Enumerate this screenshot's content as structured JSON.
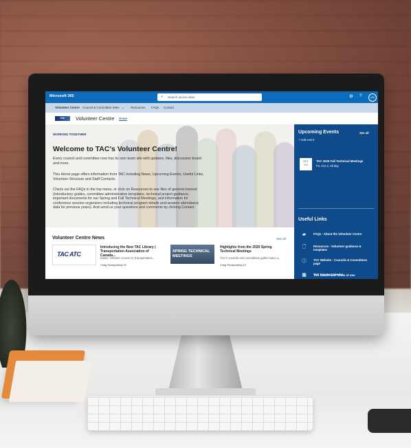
{
  "suite": {
    "brand": "Microsoft 365",
    "search_placeholder": "Search across sites",
    "settings_icon": "gear-icon",
    "help_icon": "help-icon",
    "avatar": "CB"
  },
  "hub_nav": {
    "items": [
      "Volunteer Centre",
      "Council & Committee Sites",
      "Resources",
      "FAQs",
      "Contact"
    ]
  },
  "site": {
    "logo": "TAC",
    "title": "Volunteer Centre",
    "home_link": "Home"
  },
  "hero": {
    "tag": "WORKING TOGETHER",
    "title": "Welcome to TAC's Volunteer Centre!",
    "p1": "Every council and committee now has its own team site with updates, files, discussion board and more.",
    "p2": "This Home page offers information from TAC including News, Upcoming Events, Useful Links, Volunteer Structure and Staff Contacts.",
    "p3": "Check out the FAQs in the top menu, or click on Resources to see files of general interest (introductory guides, committee administration templates, technical project guidance, important documents for our Spring and Fall Technical Meetings, and information for conference session organizers including technical program details and session attendance data for previous years). And send us your questions and comments by clicking Contact."
  },
  "news": {
    "heading": "Volunteer Centre News",
    "see_all": "See all",
    "items": [
      {
        "img_text": "TAC ATC",
        "title": "Introducing the New TAC Library | Transportation Association of Canada...",
        "desc": "Easier, Smarter Access to Transportation...",
        "author": "Craig Stockpole",
        "date": "July 10"
      },
      {
        "img_text": "SPRING TECHNICAL MEETINGS",
        "title": "Highlights from the 2025 Spring Technical Meetings",
        "desc": "TAC's councils and committees gather twice a...",
        "author": "Craig Stockpole",
        "date": "July 10"
      }
    ]
  },
  "events": {
    "heading": "Upcoming Events",
    "see_all": "See all",
    "add": "+ Add event",
    "items": [
      {
        "month": "OCT",
        "days": "3-3",
        "title": "TAC 2025 Fall Technical Meetings",
        "when": "Fri, Oct 3, All day"
      }
    ]
  },
  "useful_links": {
    "heading": "Useful Links",
    "items": [
      {
        "icon": "chat-icon",
        "label": "FAQs - About the Volunteer Centre"
      },
      {
        "icon": "document-icon",
        "label": "Resources - Volunteer guidance & templates"
      },
      {
        "icon": "info-icon",
        "label": "TAC Website - Councils & Committees page"
      },
      {
        "icon": "calendar-icon",
        "label": "TAC Events Calendar"
      },
      {
        "icon": "lightbulb-icon",
        "label": "TAC SharePoint Terms of Use"
      }
    ]
  },
  "colors": {
    "suite": "#0f6cbd",
    "panel": "#0f4a8a",
    "hub": "#c8d9ec"
  }
}
